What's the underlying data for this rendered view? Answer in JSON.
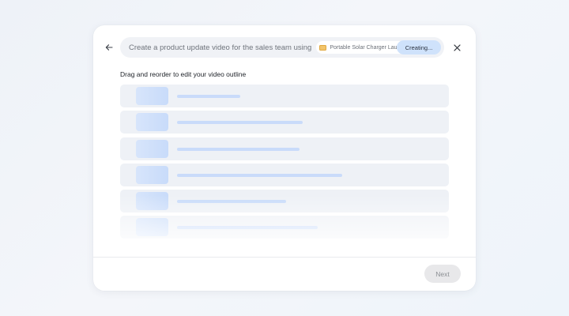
{
  "prompt": {
    "text": "Create a product update video for the sales team using",
    "chip_label": "Portable Solar Charger Launch",
    "creating_label": "Creating..."
  },
  "subtitle": "Drag and reorder to edit your video outline",
  "outline": {
    "rows": [
      {
        "line_fraction": 0.37
      },
      {
        "line_fraction": 0.74
      },
      {
        "line_fraction": 0.72
      },
      {
        "line_fraction": 0.97
      },
      {
        "line_fraction": 0.64
      },
      {
        "line_fraction": 0.83
      }
    ]
  },
  "footer": {
    "next_label": "Next"
  },
  "colors": {
    "accent": "#cfe2fb",
    "placeholder": "#c9dbfa"
  },
  "icons": {
    "back": "arrow-left-icon",
    "close": "close-icon",
    "chip": "slides-icon",
    "chip_close": "close-icon"
  }
}
